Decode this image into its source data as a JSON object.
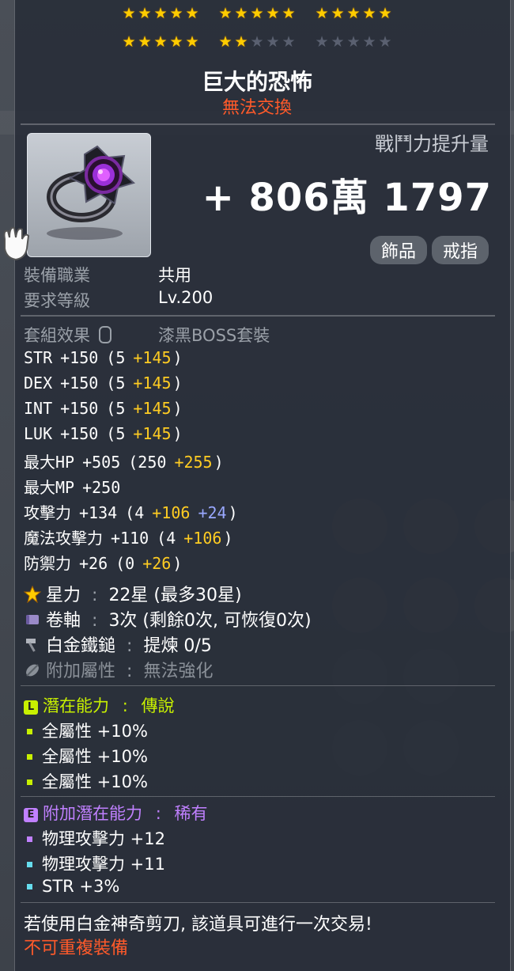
{
  "star_rows": [
    [
      [
        1,
        1,
        1,
        1,
        1
      ],
      [
        1,
        1,
        1,
        1,
        1
      ],
      [
        1,
        1,
        1,
        1,
        1
      ]
    ],
    [
      [
        1,
        1,
        1,
        1,
        1
      ],
      [
        1,
        1,
        0,
        0,
        0
      ],
      [
        0,
        0,
        0,
        0,
        0
      ]
    ]
  ],
  "item": {
    "name": "巨大的恐怖",
    "trade_status": "無法交換",
    "icon": "dark-ring-icon"
  },
  "combat_power": {
    "label": "戰鬥力提升量",
    "value": "+ 806萬 1797"
  },
  "tags": [
    "飾品",
    "戒指"
  ],
  "requirements": [
    {
      "label": "裝備職業",
      "value": "共用"
    },
    {
      "label": "要求等級",
      "value": "Lv.200"
    }
  ],
  "set_effect": {
    "label": "套組效果",
    "value": "漆黑BOSS套裝"
  },
  "stats": [
    {
      "name": "STR",
      "total": "+150",
      "base": "(5",
      "bonus1": "+145",
      "bonus2": "",
      "close": ")"
    },
    {
      "name": "DEX",
      "total": "+150",
      "base": "(5",
      "bonus1": "+145",
      "bonus2": "",
      "close": ")"
    },
    {
      "name": "INT",
      "total": "+150",
      "base": "(5",
      "bonus1": "+145",
      "bonus2": "",
      "close": ")"
    },
    {
      "name": "LUK",
      "total": "+150",
      "base": "(5",
      "bonus1": "+145",
      "bonus2": "",
      "close": ")"
    },
    {
      "name": "最大HP",
      "total": "+505",
      "base": "(250",
      "bonus1": "+255",
      "bonus2": "",
      "close": ")"
    },
    {
      "name": "最大MP",
      "total": "+250",
      "base": "",
      "bonus1": "",
      "bonus2": "",
      "close": ""
    },
    {
      "name": "攻擊力",
      "total": "+134",
      "base": "(4",
      "bonus1": "+106",
      "bonus2": "+24",
      "close": ")"
    },
    {
      "name": "魔法攻擊力",
      "total": "+110",
      "base": "(4",
      "bonus1": "+106",
      "bonus2": "",
      "close": ")"
    },
    {
      "name": "防禦力",
      "total": "+26",
      "base": "(0",
      "bonus1": "+26",
      "bonus2": "",
      "close": ")"
    }
  ],
  "enhance": [
    {
      "icon": "star-icon",
      "label": "星力",
      "sep": ":",
      "value": "22星 (最多30星)",
      "dim": false
    },
    {
      "icon": "scroll-icon",
      "label": "卷軸",
      "sep": ":",
      "value": "3次 (剩餘0次, 可恢復0次)",
      "dim": false
    },
    {
      "icon": "hammer-icon",
      "label": "白金鐵鎚",
      "sep": ":",
      "value": "提煉 0/5",
      "dim": false
    },
    {
      "icon": "leaf-icon",
      "label": "附加屬性",
      "sep": ":",
      "value": "無法強化",
      "dim": true
    }
  ],
  "potential": {
    "badge": "L",
    "label": "潛在能力",
    "sep": ":",
    "grade": "傳說",
    "color": "#c8f000",
    "lines": [
      "全屬性 +10%",
      "全屬性 +10%",
      "全屬性 +10%"
    ]
  },
  "additional_potential": {
    "badge": "E",
    "label": "附加潛在能力",
    "sep": ":",
    "grade": "稀有",
    "color": "#c080ff",
    "lines": [
      {
        "text": "物理攻擊力 +12",
        "color": "#c080ff"
      },
      {
        "text": "物理攻擊力 +11",
        "color": "#66ddee"
      },
      {
        "text": "STR +3%",
        "color": "#66ddee"
      }
    ]
  },
  "footer": {
    "note": "若使用白金神奇剪刀, 該道具可進行一次交易!",
    "warning": "不可重複裝備"
  }
}
